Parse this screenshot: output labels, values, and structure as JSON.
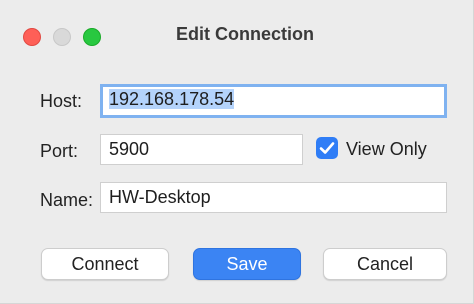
{
  "window": {
    "title": "Edit Connection"
  },
  "form": {
    "host_label": "Host:",
    "host_value": "192.168.178.54",
    "port_label": "Port:",
    "port_value": "5900",
    "view_only_label": "View Only",
    "view_only_checked": true,
    "name_label": "Name:",
    "name_value": "HW-Desktop"
  },
  "buttons": {
    "connect": "Connect",
    "save": "Save",
    "cancel": "Cancel"
  },
  "colors": {
    "accent": "#3b84f3",
    "focus_ring": "#7fb2f0",
    "close": "#fe5f57",
    "maximize": "#28c840"
  }
}
